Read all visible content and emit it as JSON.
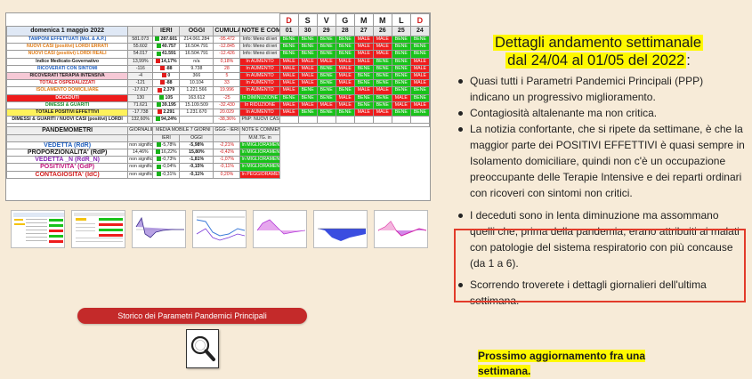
{
  "table": {
    "days": [
      "D",
      "S",
      "V",
      "G",
      "M",
      "M",
      "L",
      "D"
    ],
    "dates": [
      "01",
      "30",
      "29",
      "28",
      "27",
      "26",
      "25",
      "24"
    ],
    "header_title": "domenica 1 maggio 2022",
    "col_ieri": "IERI",
    "col_oggi": "OGGI",
    "col_cumulativo": "CUMULATIVO",
    "col_ggg": "GGG - IERI",
    "col_note": "NOTE E COMMENTI",
    "rows": [
      {
        "label": "TAMPONI EFFETTUATI (Mol. & A.P.)",
        "cls": "c-blue",
        "ieri": "581.073",
        "oggi": "287.601",
        "cum": "214.061.284",
        "diff": "-95.472",
        "note": "Info: Meno di ieri",
        "marks": [
          "BENE",
          "BENE",
          "BENE",
          "BENE",
          "MALE",
          "MALE",
          "BENE",
          "BENE"
        ]
      },
      {
        "label": "NUOVI CASI (positivi) LORDI ERRATI",
        "cls": "c-orange",
        "ieri": "55.602",
        "oggi": "40.757",
        "cum": "16.504.791",
        "diff": "-12.845",
        "note": "Info: Meno di ieri",
        "marks": [
          "BENE",
          "BENE",
          "BENE",
          "BENE",
          "MALE",
          "MALE",
          "BENE",
          "BENE"
        ]
      },
      {
        "label": "NUOVI CASI (positivi) LORDI REALI",
        "cls": "c-orange",
        "ieri": "54.017",
        "oggi": "41.591",
        "cum": "16.504.791",
        "diff": "-12.426",
        "note": "Info: Meno di ieri",
        "marks": [
          "BENE",
          "BENE",
          "BENE",
          "BENE",
          "MALE",
          "MALE",
          "BENE",
          "BENE"
        ]
      },
      {
        "label": "Indice Medicato-Governativo",
        "cls": "",
        "ieri": "13,99%",
        "oggi": "14,17%",
        "cum": "n/a",
        "diff": "0,18%",
        "note": "In AUMENTO",
        "marks": [
          "MALE",
          "MALE",
          "MALE",
          "MALE",
          "MALE",
          "BENE",
          "BENE",
          "MALE"
        ]
      },
      {
        "label": "RICOVERATI CON SINTOMI",
        "cls": "c-blue",
        "ieri": "-116",
        "oggi": "-88",
        "cum": "9.738",
        "diff": "28",
        "note": "In AUMENTO",
        "marks": [
          "MALE",
          "MALE",
          "BENE",
          "MALE",
          "BENE",
          "BENE",
          "BENE",
          "MALE"
        ]
      },
      {
        "label": "RICOVERATI TERAPIA INTENSIVA",
        "cls": "bg-pink",
        "ieri": "-4",
        "oggi": "0",
        "cum": "366",
        "diff": "5",
        "note": "In AUMENTO",
        "marks": [
          "MALE",
          "MALE",
          "BENE",
          "MALE",
          "BENE",
          "BENE",
          "BENE",
          "MALE"
        ]
      },
      {
        "label": "TOTALE OSPEDALIZZATI",
        "cls": "c-red",
        "ieri": "-121",
        "oggi": "-88",
        "cum": "10.104",
        "diff": "33",
        "note": "In AUMENTO",
        "marks": [
          "MALE",
          "MALE",
          "BENE",
          "MALE",
          "BENE",
          "BENE",
          "BENE",
          "MALE"
        ]
      },
      {
        "label": "ISOLAMENTO DOMICILIARE",
        "cls": "c-orange",
        "ieri": "-17.617",
        "oggi": "2.379",
        "cum": "1.221.566",
        "diff": "19.996",
        "note": "In AUMENTO",
        "marks": [
          "MALE",
          "BENE",
          "BENE",
          "BENE",
          "MALE",
          "MALE",
          "BENE",
          "BENE"
        ]
      },
      {
        "label": "DECEDUTI",
        "cls": "bg-red",
        "ieri": "130",
        "oggi": "105",
        "cum": "163.612",
        "diff": "-25",
        "note": "In DIMINUZIONE",
        "marks": [
          "BENE",
          "BENE",
          "BENE",
          "MALE",
          "BENE",
          "BENE",
          "MALE",
          "BENE"
        ]
      },
      {
        "label": "DIMESSI & GUARITI",
        "cls": "c-green",
        "ieri": "71.621",
        "oggi": "39.195",
        "cum": "15.109.509",
        "diff": "-32.430",
        "note": "In RIDUZIONE",
        "marks": [
          "MALE",
          "MALE",
          "MALE",
          "MALE",
          "BENE",
          "BENE",
          "MALE",
          "MALE"
        ]
      },
      {
        "label": "TOTALE POSITIVI EFFETTIVI",
        "cls": "bg-yellow",
        "ieri": "-17.738",
        "oggi": "2.291",
        "cum": "1.231.670",
        "diff": "20.029",
        "note": "In AUMENTO",
        "marks": [
          "MALE",
          "BENE",
          "BENE",
          "BENE",
          "MALE",
          "MALE",
          "BENE",
          "BENE"
        ]
      },
      {
        "label": "DIMESSI & GUARITI / NUOVI CASI (positivi) LORDI",
        "cls": "",
        "ieri": "132,60%",
        "oggi": "94,24%",
        "cum": "",
        "diff": "-38,36%",
        "note": "PNP: NUOVI CASI che DIMET",
        "marks": [
          "",
          "",
          "",
          "",
          "",
          "",
          "",
          ""
        ]
      }
    ],
    "pandemometri_title": "PANDEMOMETRI",
    "giornaliero": "GIORNALIERO",
    "media_mobile": "MEDIA MOBILE 7 GIORNI",
    "mm7g": "M.M.7G. in",
    "pand_rows": [
      {
        "label": "VEDETTA (RdR)",
        "cls": "c-blue",
        "giorn": "non significativo",
        "ieri": "-5,78%",
        "oggi": "-5,98%",
        "diff": "-2,21%",
        "note": "In MIGLIORAMENTO"
      },
      {
        "label": "PROPORZIONALITA' (RdP)",
        "cls": "",
        "giorn": "14,46%",
        "ieri": "16,22%",
        "oggi": "15,80%",
        "diff": "-0,42%",
        "note": "In MIGLIORAMENTO"
      },
      {
        "label": "VEDETTA _N (RdR_N)",
        "cls": "c-purple",
        "giorn": "non significativo",
        "ieri": "-0,73%",
        "oggi": "-1,81%",
        "diff": "-1,07%",
        "note": "In MIGLIORAMENTO"
      },
      {
        "label": "POSITIVITA' (GdP)",
        "cls": "c-magenta",
        "giorn": "non significativo",
        "ieri": "-0,04%",
        "oggi": "-0,15%",
        "diff": "-0,11%",
        "note": "In MIGLIORAMENTO"
      },
      {
        "label": "CONTAGIOSITA' (IdC)",
        "cls": "c-red",
        "giorn": "non significativo",
        "ieri": "-0,31%",
        "oggi": "-0,11%",
        "diff": "0,20%",
        "note": "In PEGGIORAMENTO"
      }
    ]
  },
  "storico_label": "Storico dei Parametri Pandemici Principali",
  "right": {
    "title_line1": "Dettagli andamento settimanale",
    "title_line2": "dal 24/04 al 01/05 del 2022",
    "title_colon": ":",
    "bullets": [
      "Quasi tutti i Parametri Pandemici Principali (PPP) indicano un progressivo miglioramento.",
      "Contagiosità altalenante ma non critica.",
      "La notizia confortante, che si ripete da settimane, è che la maggior parte dei POSITIVI EFFETTIVI è quasi sempre in Isolamento domiciliare, quindi non c'è un occupazione preoccupante delle Terapie Intensive e dei reparti ordinari con ricoveri con sintomi non critici.",
      "I deceduti sono in lenta diminuzione ma assommano quelli che, prima della pandemia, erano attribuiti ai malati con patologie del sistema respiratorio con più concause (da 1 a 6).",
      "Scorrendo troverete i dettagli giornalieri dell'ultima settimana."
    ],
    "next_line1": "Prossimo aggiornamento fra una",
    "next_line2": "settimana."
  },
  "colors": {
    "bene": "#19c21a",
    "male": "#ee1c1c",
    "accent_red": "#c42a2a",
    "highlight": "#fff800",
    "box_red": "#e23b2a"
  }
}
